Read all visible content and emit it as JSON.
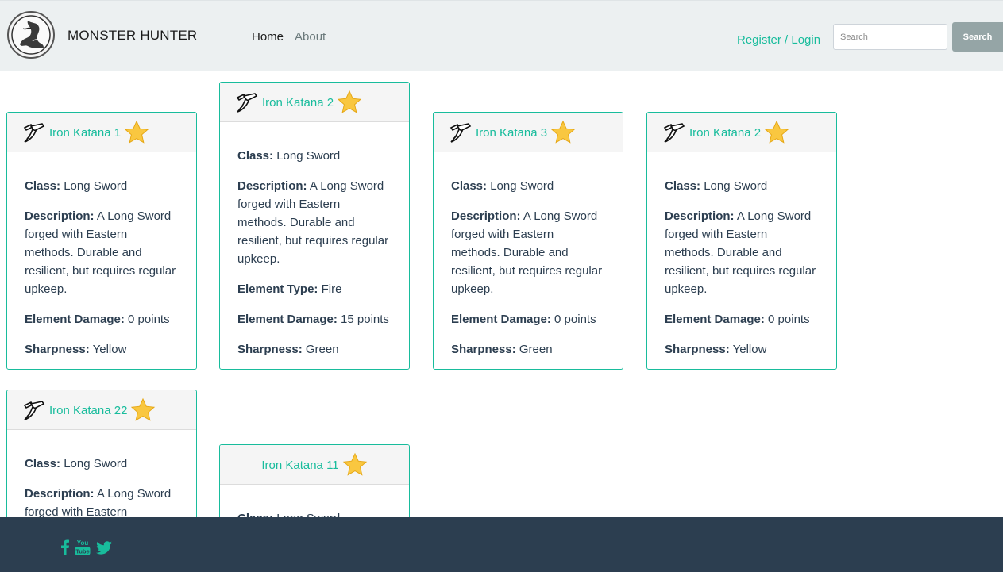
{
  "nav": {
    "brand": "MONSTER HUNTER",
    "home": "Home",
    "about": "About",
    "register": "Register / Login",
    "search_placeholder": "Search",
    "search_button": "Search"
  },
  "labels": {
    "class": "Class:",
    "description": "Description:",
    "element_type": "Element Type:",
    "element_damage": "Element Damage:",
    "sharpness": "Sharpness:"
  },
  "cards": [
    {
      "title": "Iron Katana 1",
      "class": "Long Sword",
      "description": "A Long Sword forged with Eastern methods. Durable and resilient, but requires regular upkeep.",
      "element_damage": "0 points",
      "sharpness": "Yellow"
    },
    {
      "title": "Iron Katana 2",
      "class": "Long Sword",
      "description": "A Long Sword forged with Eastern methods. Durable and resilient, but requires regular upkeep.",
      "element_type": "Fire",
      "element_damage": "15 points",
      "sharpness": "Green"
    },
    {
      "title": "Iron Katana 3",
      "class": "Long Sword",
      "description": "A Long Sword forged with Eastern methods. Durable and resilient, but requires regular upkeep.",
      "element_damage": "0 points",
      "sharpness": "Green"
    },
    {
      "title": "Iron Katana 2",
      "class": "Long Sword",
      "description": "A Long Sword forged with Eastern methods. Durable and resilient, but requires regular upkeep.",
      "element_damage": "0 points",
      "sharpness": "Yellow"
    },
    {
      "title": "Iron Katana 22",
      "class": "Long Sword",
      "description": "A Long Sword forged with Eastern methods. Durable and resilient, but requires regular upkeep."
    },
    {
      "title": "Iron Katana 11",
      "class": "Long Sword"
    }
  ],
  "icons": {
    "weapon": "katana-icon",
    "favorite": "star-icon",
    "social": [
      "facebook-icon",
      "youtube-icon",
      "twitter-icon"
    ]
  },
  "colors": {
    "accent": "#18bc9c",
    "navbar": "#ecf0f1",
    "footer": "#2c3e50",
    "star": "#f9c740",
    "search_button": "#95a5a6"
  }
}
